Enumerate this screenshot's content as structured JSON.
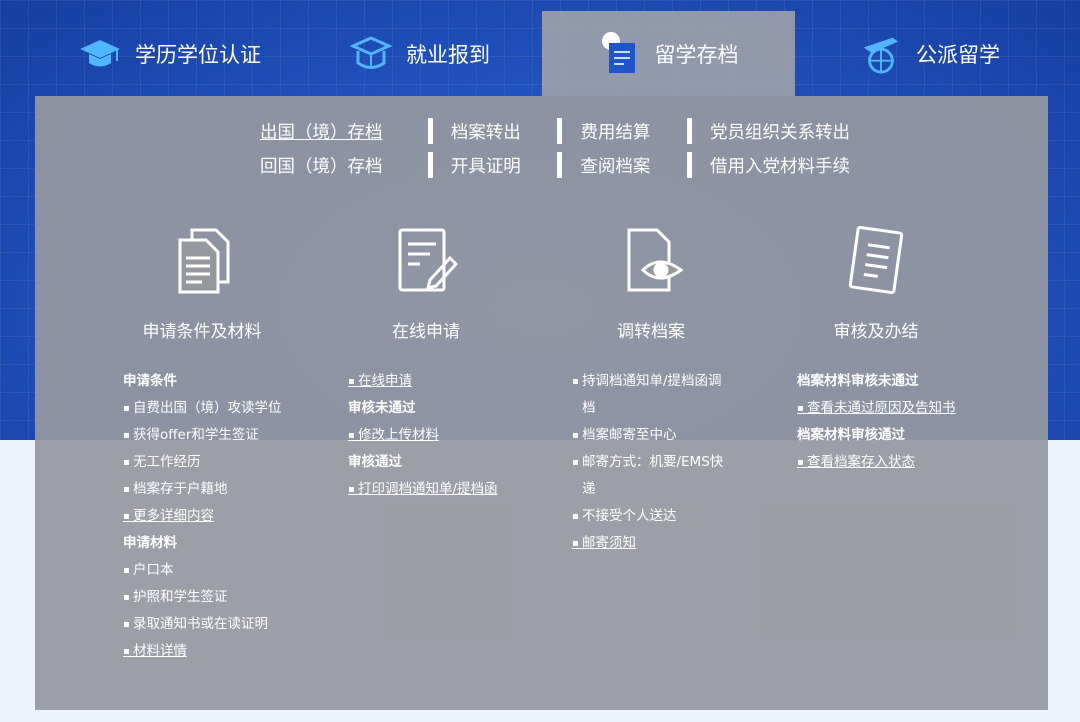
{
  "tabs": [
    {
      "label": "学历学位认证",
      "icon": "graduation-cap-icon"
    },
    {
      "label": "就业报到",
      "icon": "open-book-icon"
    },
    {
      "label": "留学存档",
      "icon": "document-archive-icon"
    },
    {
      "label": "公派留学",
      "icon": "airplane-globe-icon"
    }
  ],
  "subnav": {
    "row1": [
      "出国（境）存档",
      "档案转出",
      "费用结算",
      "党员组织关系转出"
    ],
    "row2": [
      "回国（境）存档",
      "开具证明",
      "查阅档案",
      "借用入党材料手续"
    ]
  },
  "steps": [
    {
      "label": "申请条件及材料",
      "icon": "documents-icon"
    },
    {
      "label": "在线申请",
      "icon": "form-edit-icon"
    },
    {
      "label": "调转档案",
      "icon": "document-eye-icon"
    },
    {
      "label": "审核及办结",
      "icon": "checklist-icon"
    }
  ],
  "col1": {
    "h1": "申请条件",
    "items1": [
      "自费出国（境）攻读学位",
      "获得offer和学生签证",
      "无工作经历",
      "档案存于户籍地",
      "更多详细内容"
    ],
    "h2": "申请材料",
    "items2": [
      "户口本",
      "护照和学生签证",
      "录取通知书或在读证明",
      "材料详情"
    ]
  },
  "col2": {
    "item1": "在线申请",
    "h1": "审核未通过",
    "item2": "修改上传材料",
    "h2": "审核通过",
    "item3": "打印调档通知单/提档函"
  },
  "col3": {
    "items": [
      "持调档通知单/提档函调",
      "档",
      "档案邮寄至中心",
      "邮寄方式：机要/EMS快",
      "递",
      "不接受个人送达",
      "邮寄须知"
    ]
  },
  "col4": {
    "h1": "档案材料审核未通过",
    "item1": "查看未通过原因及告知书",
    "h2": "档案材料审核通过",
    "item2": "查看档案存入状态"
  },
  "colors": {
    "accent_blue": "#2a5fd0",
    "panel_gray": "#9698a0"
  }
}
